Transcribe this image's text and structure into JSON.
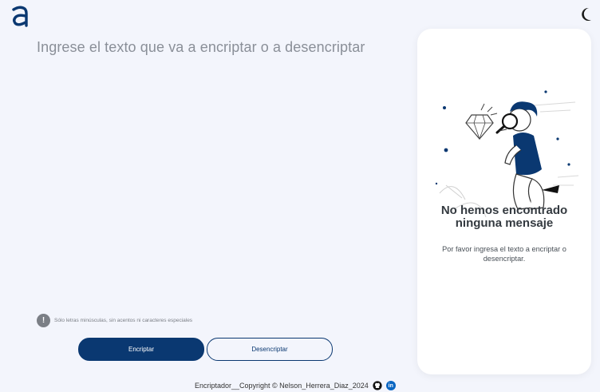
{
  "header": {
    "logo_icon": "alura-logo-icon",
    "theme_toggle_icon": "moon-icon"
  },
  "main": {
    "placeholder": "Ingrese el texto que va a encriptar o a desencriptar",
    "warning_icon": "exclamation-icon",
    "warning_text": "Sólo letras minúsculas, sin acentos ni caracteres especiales",
    "encrypt_label": "Encriptar",
    "decrypt_label": "Desencriptar"
  },
  "result_panel": {
    "illustration": "person-with-magnifying-glass-illustration",
    "title_line1": "No hemos encontrado",
    "title_line2": "ninguna mensaje",
    "subtitle": "Por favor ingresa el texto a encriptar o desencriptar."
  },
  "footer": {
    "text": "Encriptador__Copyright © Nelson_Herrera_Diaz_2024",
    "github_icon": "github-icon",
    "linkedin_icon": "linkedin-icon",
    "linkedin_glyph": "in"
  },
  "colors": {
    "primary": "#0a3871",
    "background": "#f3f5fc",
    "panel": "#ffffff"
  }
}
